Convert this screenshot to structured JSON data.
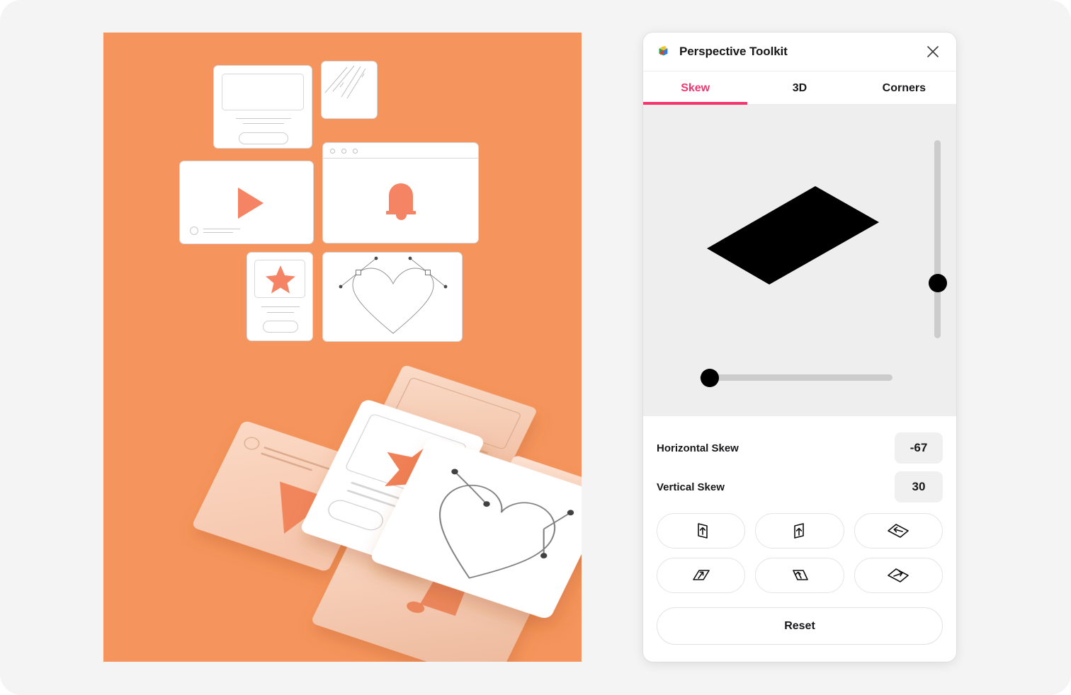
{
  "theme": {
    "canvas_bg": "#f5945c",
    "page_bg": "#f4f4f5",
    "accent": "#f5356e",
    "glyph_orange": "#f58464",
    "preview_bg": "#eeeeee",
    "shape_fill": "#000000",
    "slider_track": "#cccccc",
    "value_pill_bg": "#f0f0f0"
  },
  "panel": {
    "title": "Perspective Toolkit",
    "logo_icon": "isometric-cube-logo",
    "close_icon": "close-icon",
    "tabs": [
      {
        "label": "Skew",
        "active": true
      },
      {
        "label": "3D",
        "active": false
      },
      {
        "label": "Corners",
        "active": false
      }
    ],
    "preview": {
      "shape": "skewed-parallelogram",
      "vertical_slider": {
        "name": "vertical-skew-slider",
        "value_pct": 72
      },
      "horizontal_slider": {
        "name": "horizontal-skew-slider",
        "value_pct": 5
      }
    },
    "controls": [
      {
        "label": "Horizontal Skew",
        "value": "-67",
        "name": "horizontal-skew"
      },
      {
        "label": "Vertical Skew",
        "value": "30",
        "name": "vertical-skew"
      }
    ],
    "skew_buttons": [
      {
        "name": "skew-top-up-icon",
        "variant": "v-left-up"
      },
      {
        "name": "skew-top-down-icon",
        "variant": "v-right-up"
      },
      {
        "name": "skew-left-icon",
        "variant": "h-left"
      },
      {
        "name": "skew-bottom-right-icon",
        "variant": "d-right-up"
      },
      {
        "name": "skew-bottom-left-icon",
        "variant": "d-left-up"
      },
      {
        "name": "skew-right-icon",
        "variant": "h-right"
      }
    ],
    "reset_label": "Reset"
  },
  "illustration": {
    "name": "perspective-skew-illustration",
    "description": "Flat UI cards above, isometric skewed card stack below on orange background",
    "flat_cards": [
      {
        "name": "card-form",
        "glyph": "none"
      },
      {
        "name": "card-scribble",
        "glyph": "scribble-lines"
      },
      {
        "name": "card-video",
        "glyph": "play-icon"
      },
      {
        "name": "card-browser",
        "glyph": "bell-icon"
      },
      {
        "name": "card-star",
        "glyph": "star-icon"
      },
      {
        "name": "card-heart",
        "glyph": "heart-path-icon"
      }
    ],
    "iso_cards": [
      {
        "name": "iso-card-video",
        "glyph": "play-icon"
      },
      {
        "name": "iso-card-form",
        "glyph": "none"
      },
      {
        "name": "iso-card-scribble",
        "glyph": "scribble-lines"
      },
      {
        "name": "iso-card-browser",
        "glyph": "bell-icon"
      },
      {
        "name": "iso-card-star",
        "glyph": "star-icon"
      },
      {
        "name": "iso-card-heart",
        "glyph": "heart-path-icon"
      }
    ]
  }
}
